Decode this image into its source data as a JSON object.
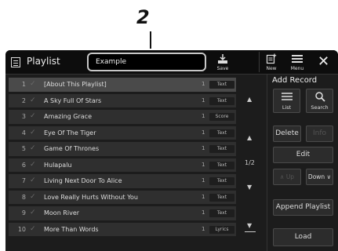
{
  "callout": {
    "number": "2"
  },
  "header": {
    "title": "Playlist",
    "playlist_name": "Example",
    "save_label": "Save",
    "new_label": "New",
    "menu_label": "Menu",
    "close_glyph": "✕"
  },
  "records": [
    {
      "index": "1",
      "title": "[About This Playlist]",
      "count": "1",
      "type": "Text",
      "selected": true
    },
    {
      "index": "2",
      "title": "A Sky Full Of Stars",
      "count": "1",
      "type": "Text"
    },
    {
      "index": "3",
      "title": "Amazing Grace",
      "count": "1",
      "type": "Score"
    },
    {
      "index": "4",
      "title": "Eye Of The Tiger",
      "count": "1",
      "type": "Text"
    },
    {
      "index": "5",
      "title": "Game Of Thrones",
      "count": "1",
      "type": "Text"
    },
    {
      "index": "6",
      "title": "Hulapalu",
      "count": "1",
      "type": "Text"
    },
    {
      "index": "7",
      "title": "Living Next Door To Alice",
      "count": "1",
      "type": "Text"
    },
    {
      "index": "8",
      "title": "Love Really Hurts Without You",
      "count": "1",
      "type": "Text"
    },
    {
      "index": "9",
      "title": "Moon River",
      "count": "1",
      "type": "Text"
    },
    {
      "index": "10",
      "title": "More Than Words",
      "count": "1",
      "type": "Lyrics"
    }
  ],
  "pagination": {
    "page": "1/2"
  },
  "side_panel": {
    "add_record_title": "Add Record",
    "list_label": "List",
    "search_label": "Search",
    "delete_label": "Delete",
    "info_label": "Info",
    "edit_label": "Edit",
    "up_label": "Up",
    "down_label": "Down",
    "append_playlist_label": "Append Playlist",
    "load_label": "Load"
  },
  "glyphs": {
    "check": "✓",
    "arrow_up": "▲",
    "arrow_down": "▼",
    "chevron_up": "∧",
    "chevron_down": "∨"
  }
}
